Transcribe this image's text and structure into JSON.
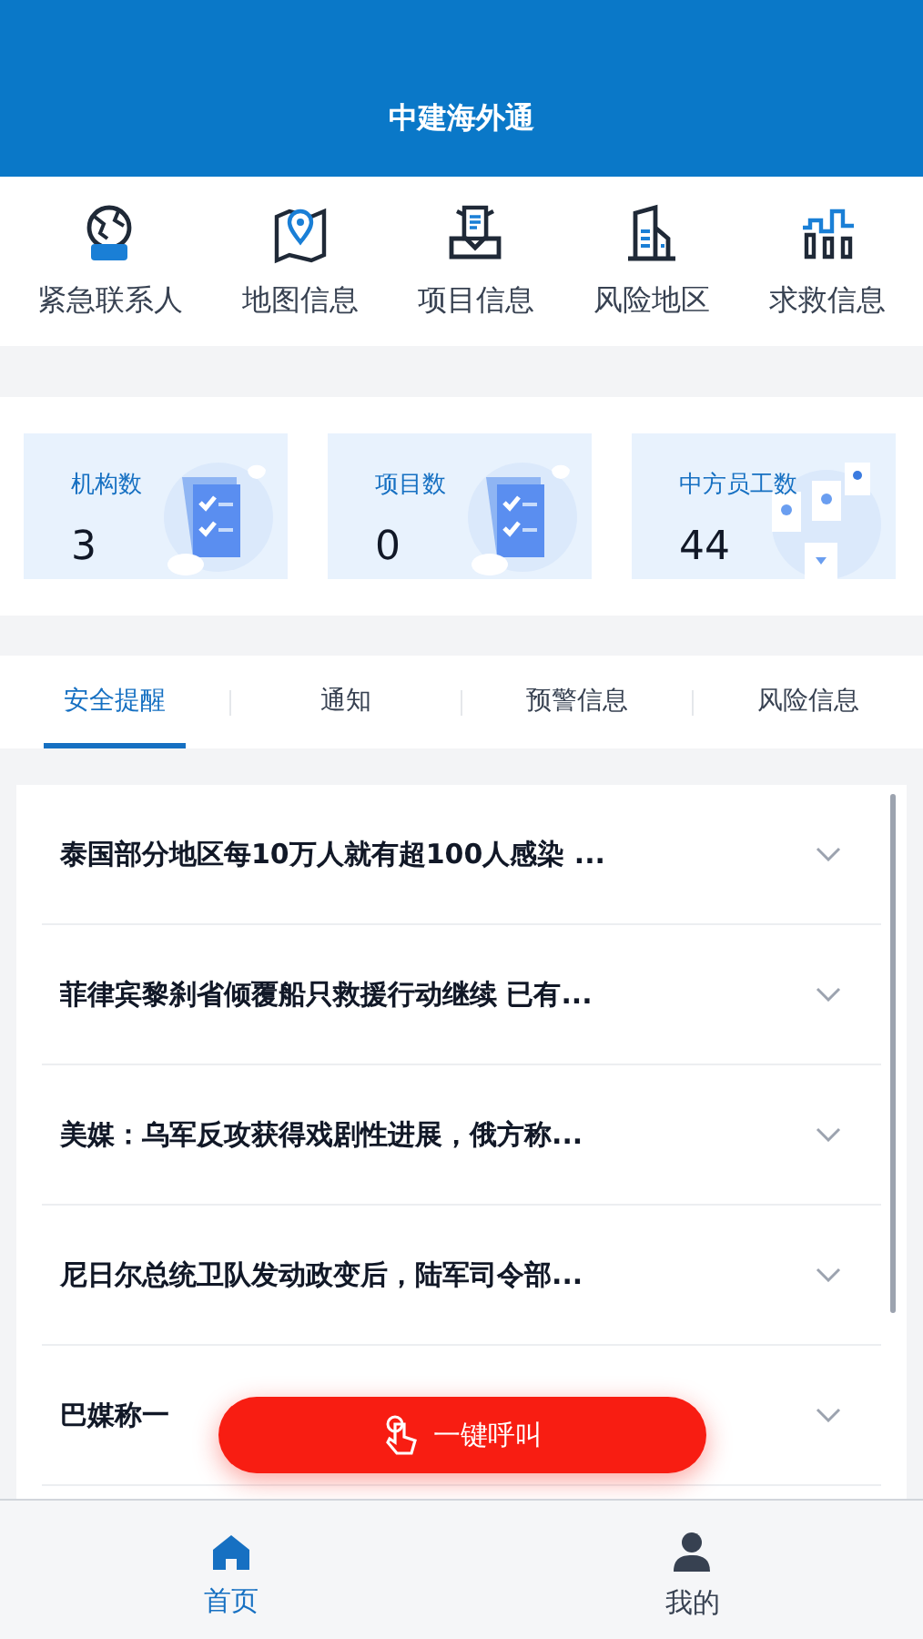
{
  "header": {
    "title": "中建海外通"
  },
  "shortcuts": [
    {
      "label": "紧急联系人",
      "kind": "sos"
    },
    {
      "label": "地图信息",
      "kind": "map"
    },
    {
      "label": "项目信息",
      "kind": "docs"
    },
    {
      "label": "风险地区",
      "kind": "building"
    },
    {
      "label": "求救信息",
      "kind": "signal"
    }
  ],
  "stats": [
    {
      "label": "机构数",
      "value": "3",
      "kind": "checklist"
    },
    {
      "label": "项目数",
      "value": "0",
      "kind": "checklist"
    },
    {
      "label": "中方员工数",
      "value": "44",
      "kind": "people"
    }
  ],
  "tabs": [
    {
      "label": "安全提醒",
      "selected": true
    },
    {
      "label": "通知",
      "selected": false
    },
    {
      "label": "预警信息",
      "selected": false
    },
    {
      "label": "风险信息",
      "selected": false
    }
  ],
  "news": [
    {
      "title": "泰国部分地区每10万人就有超100人感染 ..."
    },
    {
      "title": "菲律宾黎刹省倾覆船只救援行动继续 已有..."
    },
    {
      "title": "美媒：乌军反攻获得戏剧性进展，俄方称..."
    },
    {
      "title": "尼日尔总统卫队发动政变后，陆军司令部..."
    },
    {
      "title": "巴媒称一"
    }
  ],
  "call_button": {
    "label": "一键呼叫"
  },
  "bottom_nav": [
    {
      "label": "首页",
      "kind": "home",
      "selected": true
    },
    {
      "label": "我的",
      "kind": "user",
      "selected": false
    }
  ]
}
